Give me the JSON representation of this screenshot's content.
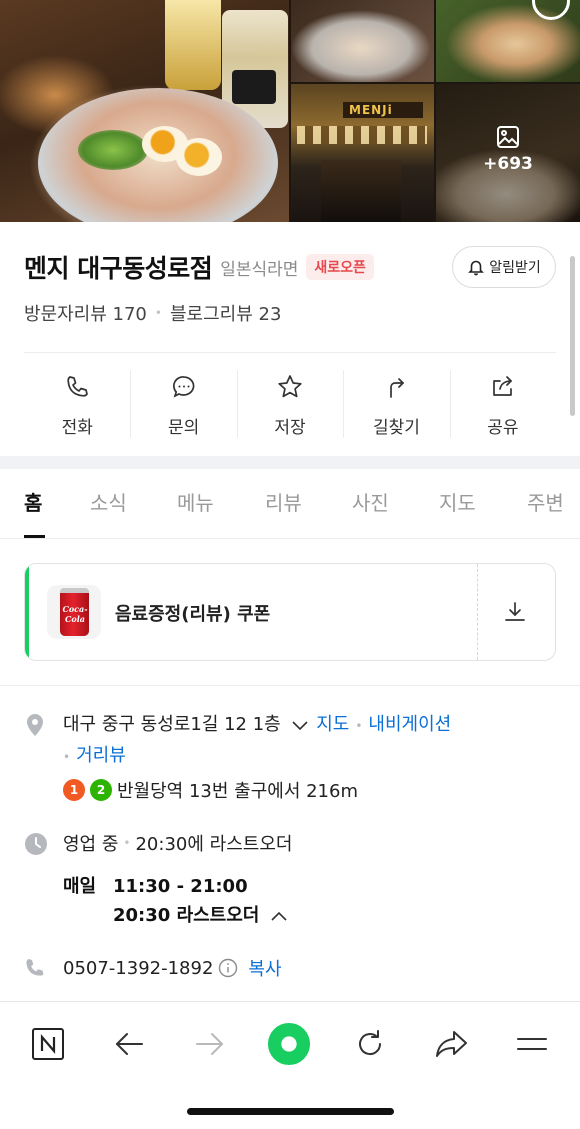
{
  "gallery": {
    "more_count": "+693",
    "storefront_sign": "MENJi"
  },
  "place": {
    "name": "멘지 대구동성로점",
    "category": "일본식라면",
    "badge": "새로오픈",
    "notify_label": "알림받기",
    "visitor_reviews": "방문자리뷰 170",
    "blog_reviews": "블로그리뷰 23"
  },
  "actions": [
    {
      "label": "전화",
      "icon": "phone-icon"
    },
    {
      "label": "문의",
      "icon": "chat-bubble-icon"
    },
    {
      "label": "저장",
      "icon": "star-icon"
    },
    {
      "label": "길찾기",
      "icon": "directions-icon"
    },
    {
      "label": "공유",
      "icon": "share-icon"
    }
  ],
  "tabs": [
    "홈",
    "소식",
    "메뉴",
    "리뷰",
    "사진",
    "지도",
    "주변"
  ],
  "active_tab": "홈",
  "coupon": {
    "title": "음료증정(리뷰) 쿠폰",
    "product_text": "Coca-Cola"
  },
  "address": {
    "text": "대구 중구 동성로1길 12 1층",
    "map_link": "지도",
    "navigation_link": "내비게이션",
    "street_view_link": "거리뷰"
  },
  "subway": {
    "lines": [
      {
        "number": "1",
        "color": "#f15a22"
      },
      {
        "number": "2",
        "color": "#2db400"
      }
    ],
    "text": "반월당역 13번 출구에서 216m"
  },
  "hours": {
    "status": "영업 중",
    "last_order_note": "20:30에 라스트오더",
    "day": "매일",
    "time": "11:30 - 21:00",
    "last_order": "20:30 라스트오더"
  },
  "phone": {
    "number": "0507-1392-1892",
    "copy_label": "복사"
  },
  "colors": {
    "naver_green": "#19ce60",
    "link_blue": "#0b6fd6",
    "badge_red": "#e5484d"
  }
}
